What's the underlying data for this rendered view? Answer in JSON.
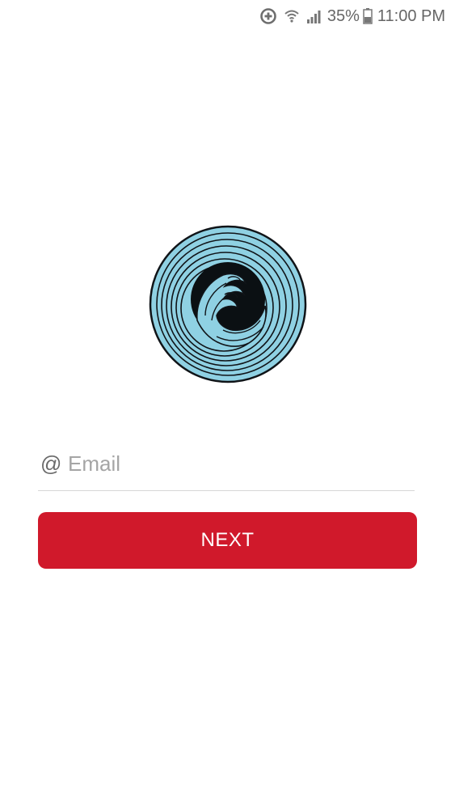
{
  "status_bar": {
    "icons": [
      "data-saver-icon",
      "wifi-icon",
      "signal-icon",
      "battery-icon"
    ],
    "battery_percent": "35%",
    "time": "11:00 PM"
  },
  "logo": {
    "icon": "wave-logo",
    "colors": {
      "ring": "#8fd1e3",
      "center": "#0b1013",
      "outline": "#101418"
    }
  },
  "form": {
    "email": {
      "icon": "at-icon",
      "icon_glyph": "@",
      "placeholder": "Email",
      "value": ""
    },
    "next_label": "NEXT"
  },
  "colors": {
    "accent": "#d0192b",
    "background": "#ffffff",
    "divider": "#d6d6d6"
  }
}
